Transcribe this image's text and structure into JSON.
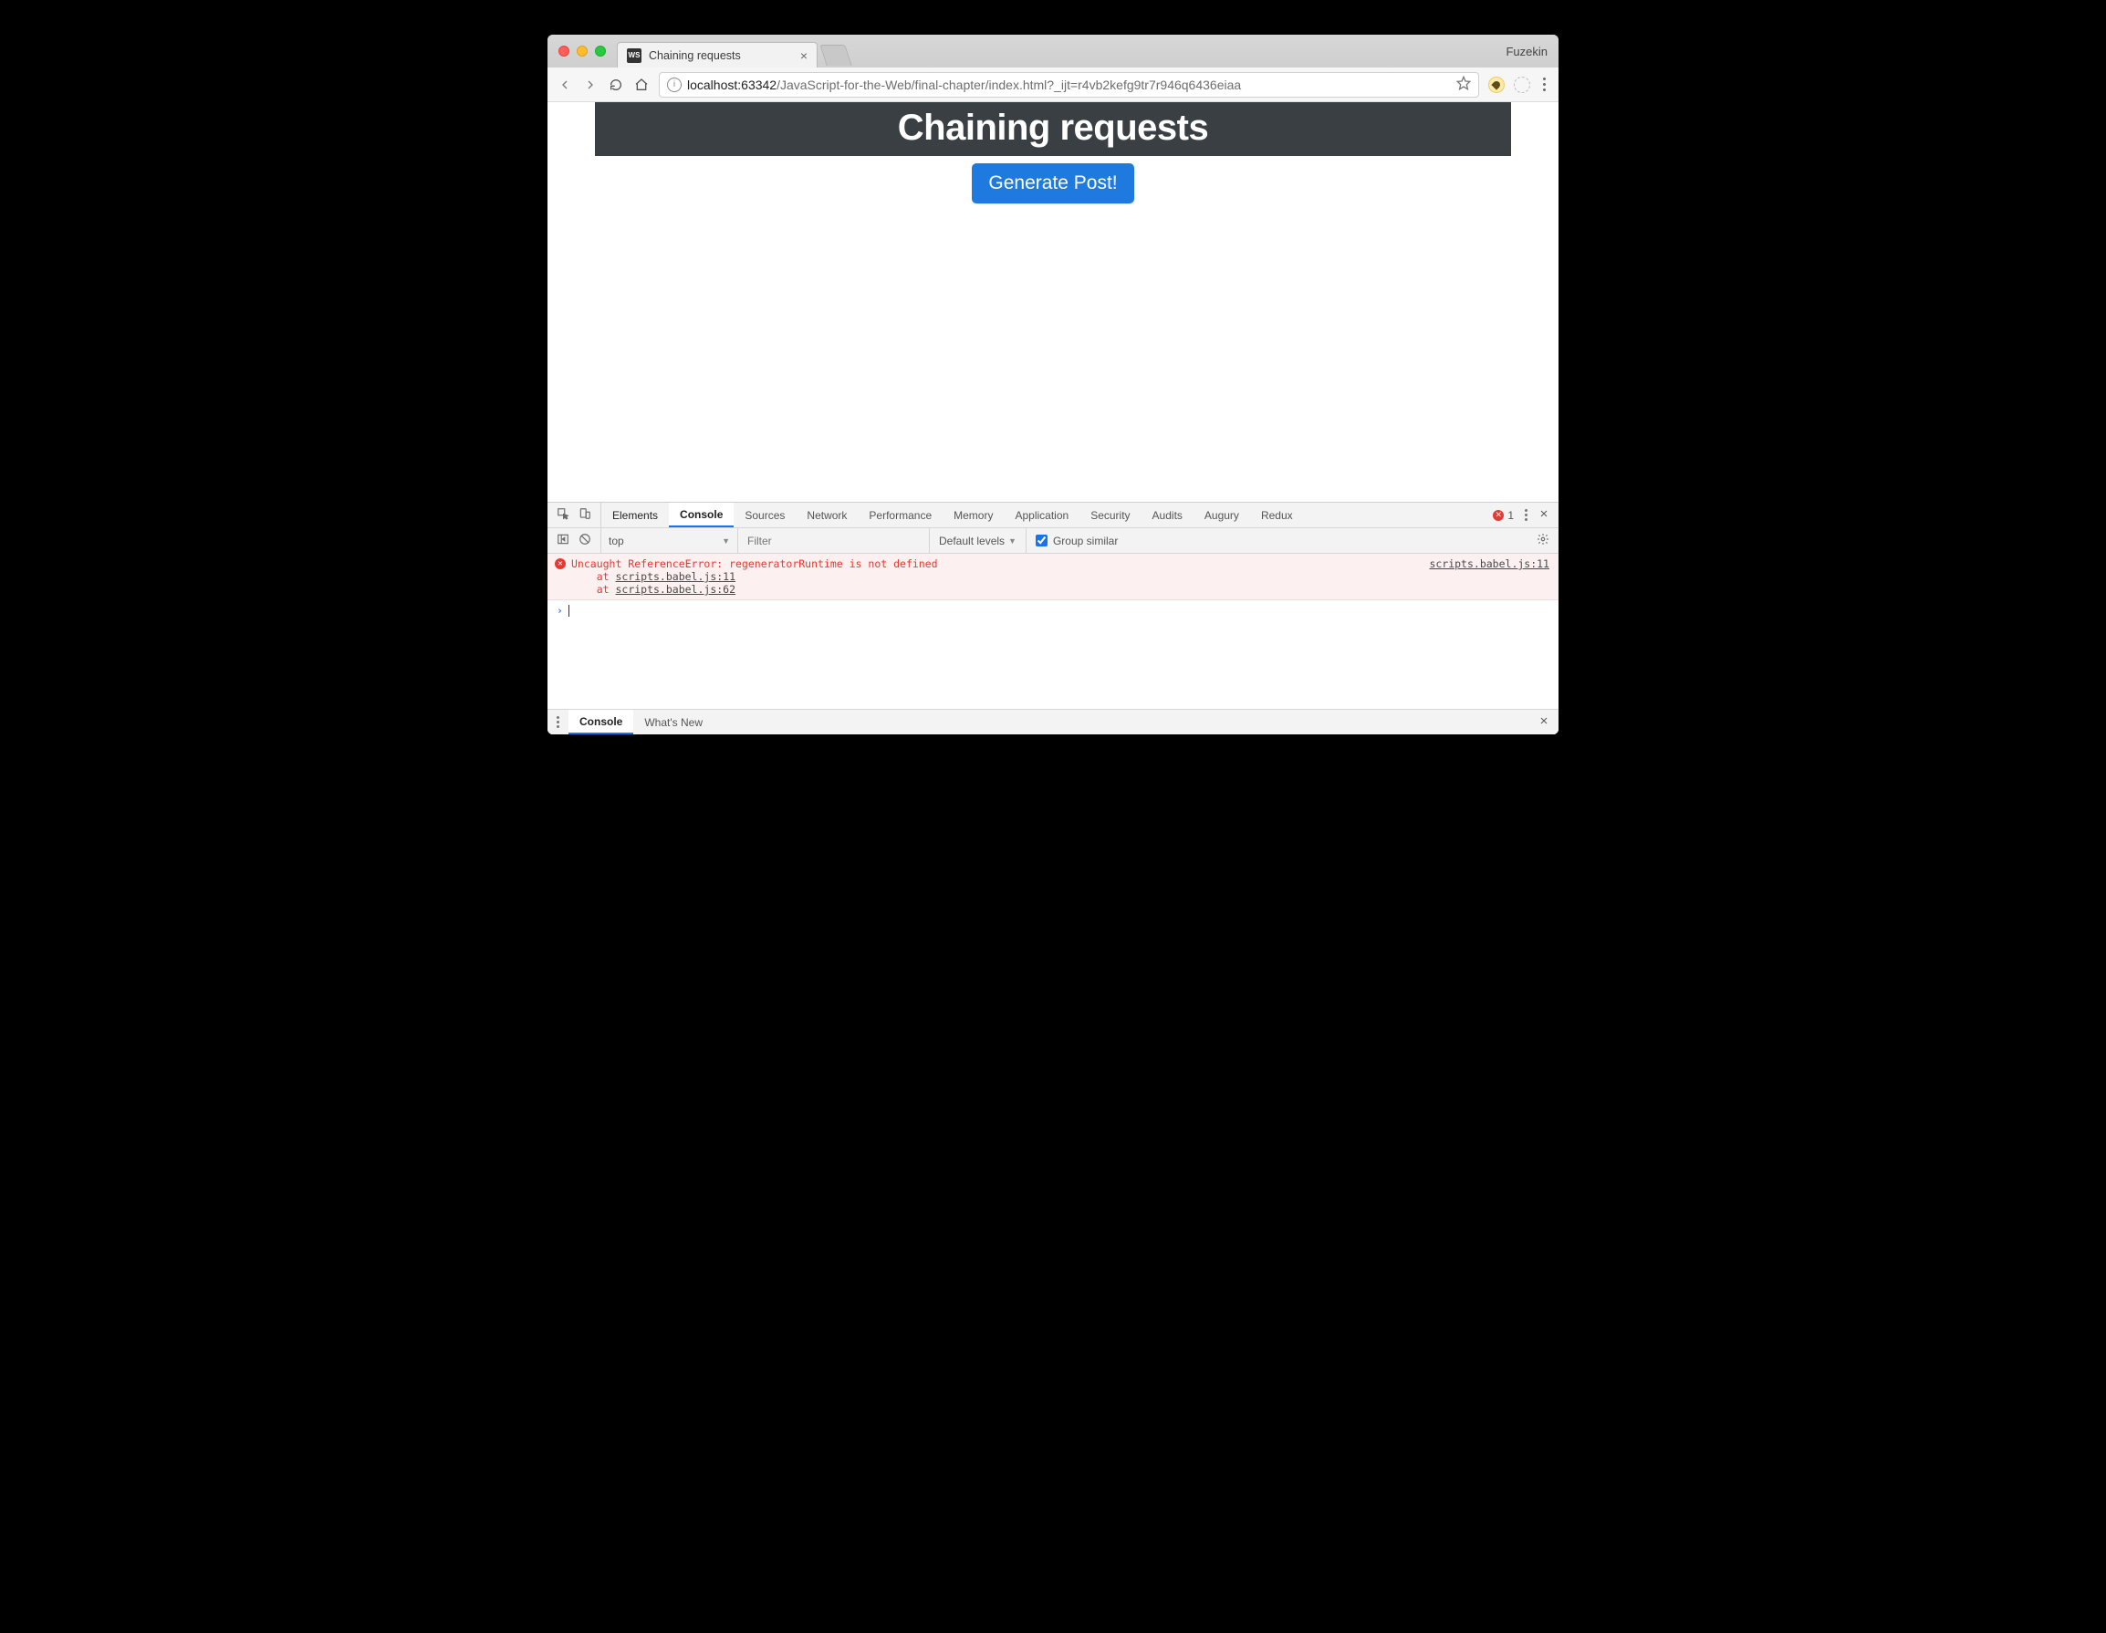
{
  "chrome": {
    "profile_name": "Fuzekin",
    "tab": {
      "favicon_text": "WS",
      "title": "Chaining requests"
    },
    "url": {
      "host": "localhost",
      "port": ":63342",
      "path": "/JavaScript-for-the-Web/final-chapter/index.html?_ijt=r4vb2kefg9tr7r946q6436eiaa"
    }
  },
  "page": {
    "heading": "Chaining requests",
    "button_label": "Generate Post!"
  },
  "devtools": {
    "tabs": {
      "elements": "Elements",
      "console": "Console",
      "sources": "Sources",
      "network": "Network",
      "performance": "Performance",
      "memory": "Memory",
      "application": "Application",
      "security": "Security",
      "audits": "Audits",
      "augury": "Augury",
      "redux": "Redux"
    },
    "error_count": "1",
    "toolbar": {
      "context": "top",
      "filter_placeholder": "Filter",
      "levels_label": "Default levels",
      "group_label": "Group similar"
    },
    "error": {
      "message": "Uncaught ReferenceError: regeneratorRuntime is not defined",
      "at1_prefix": "    at ",
      "at1_link": "scripts.babel.js:11",
      "at2_prefix": "    at ",
      "at2_link": "scripts.babel.js:62",
      "source_link": "scripts.babel.js:11"
    },
    "drawer": {
      "console": "Console",
      "whatsnew": "What's New"
    }
  }
}
